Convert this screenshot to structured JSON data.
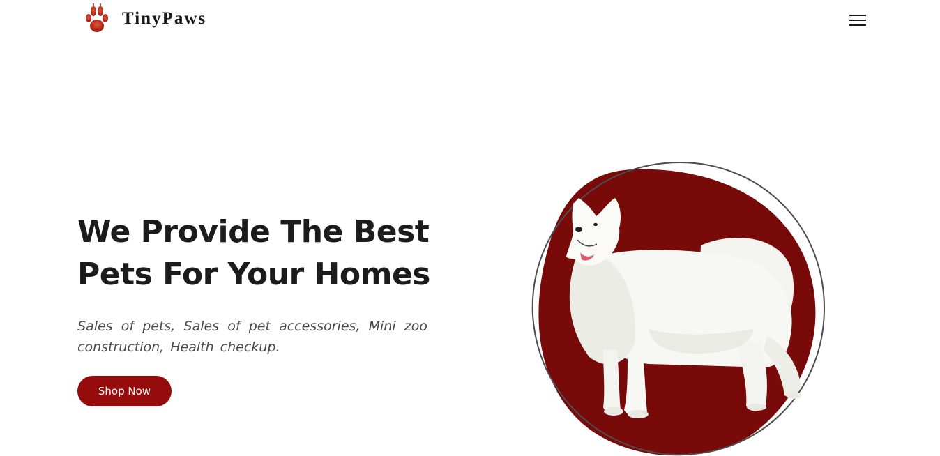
{
  "header": {
    "brand": "TinyPaws",
    "logo_icon": "paw-print-icon",
    "menu_icon": "hamburger-menu-icon"
  },
  "hero": {
    "title_line1": "We Provide The Best",
    "title_line2": "Pets For Your Homes",
    "subtitle": "Sales of pets, Sales of pet accessories, Mini zoo construction, Health checkup.",
    "cta_label": "Shop Now",
    "image_subject": "white-samoyed-dog"
  },
  "colors": {
    "accent": "#960b0b",
    "blob": "#780a0a",
    "heading": "#1c1c1c",
    "body_text": "#4a4a4a"
  }
}
